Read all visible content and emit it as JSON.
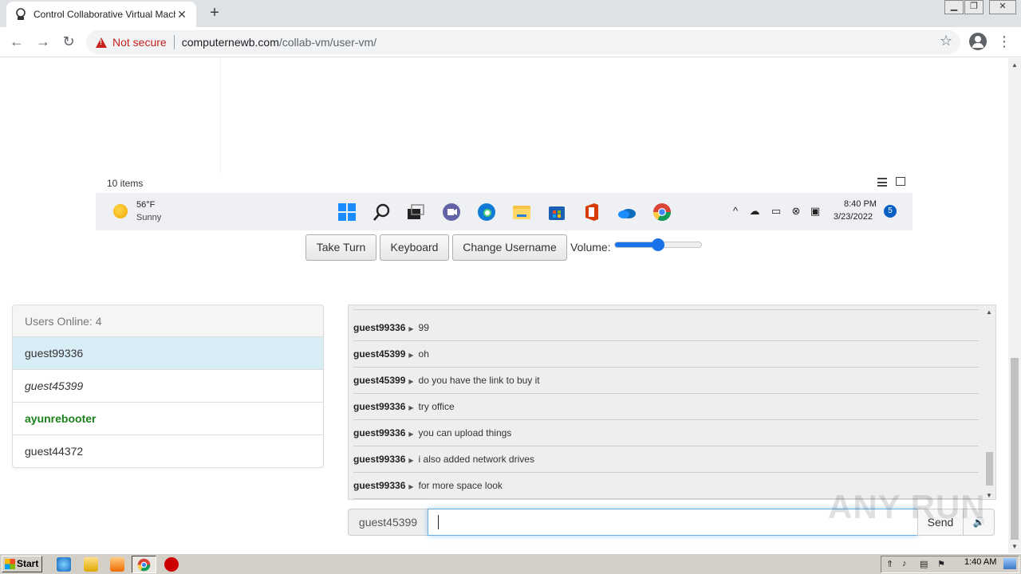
{
  "browser": {
    "tab_title": "Control Collaborative Virtual Machine",
    "security_label": "Not secure",
    "url_host": "computernewb.com",
    "url_path": "/collab-vm/user-vm/"
  },
  "vm": {
    "explorer_status": "10 items",
    "weather": {
      "temp": "56°F",
      "desc": "Sunny"
    },
    "clock_time": "8:40 PM",
    "clock_date": "3/23/2022",
    "notification_count": "5",
    "taskbar_icons": [
      "windows-start-icon",
      "search-icon",
      "task-view-icon",
      "teams-chat-icon",
      "edge-icon",
      "file-explorer-icon",
      "microsoft-store-icon",
      "office-icon",
      "onedrive-icon",
      "chrome-icon"
    ]
  },
  "controls": {
    "take_turn": "Take Turn",
    "keyboard": "Keyboard",
    "change_username": "Change Username",
    "volume_label": "Volume:",
    "volume_level": 0.5
  },
  "users": {
    "heading": "Users Online: 4",
    "list": [
      "guest99336",
      "guest45399",
      "ayunrebooter",
      "guest44372"
    ]
  },
  "chat": {
    "messages": [
      {
        "user": "guest99336",
        "text": "99"
      },
      {
        "user": "guest45399",
        "text": "oh"
      },
      {
        "user": "guest45399",
        "text": "do you have the link to buy it"
      },
      {
        "user": "guest99336",
        "text": "try office"
      },
      {
        "user": "guest99336",
        "text": "you can upload things"
      },
      {
        "user": "guest99336",
        "text": "i also added network drives"
      },
      {
        "user": "guest99336",
        "text": "for more space look"
      }
    ],
    "username": "guest45399",
    "input_value": "",
    "send_label": "Send"
  },
  "watermark": "ANY RUN",
  "host": {
    "start_label": "Start",
    "clock": "1:40 AM"
  },
  "colors": {
    "accent": "#1a73e8",
    "admin_user": "#1b7f1b",
    "active_user_bg": "#d9edf7",
    "not_secure": "#c5221f"
  }
}
